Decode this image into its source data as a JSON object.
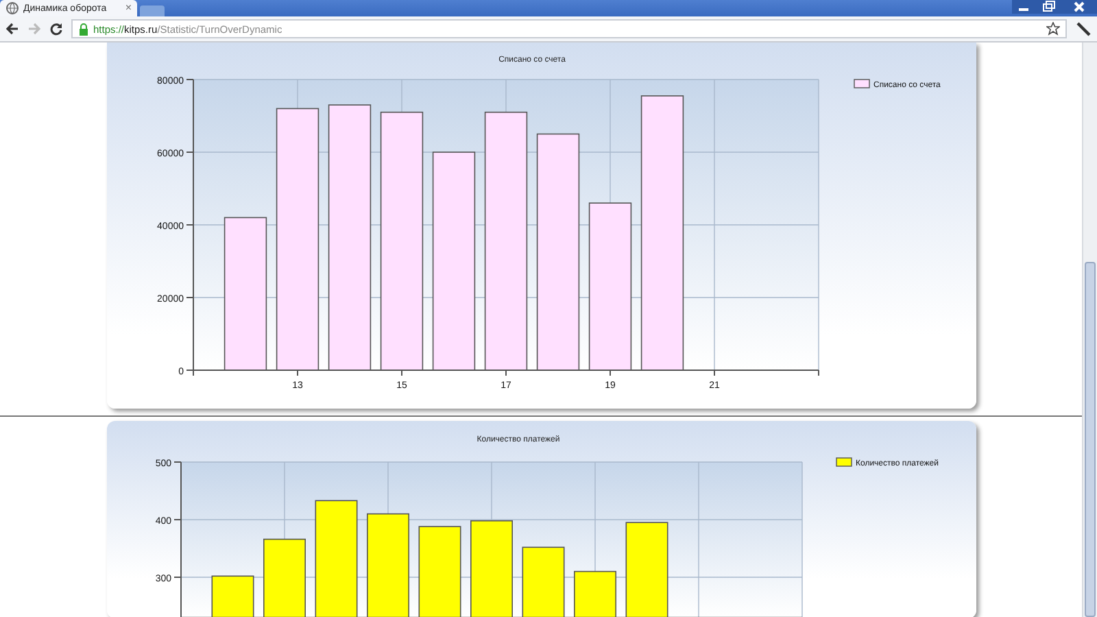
{
  "browser": {
    "tab": {
      "title": "Динамика оборота",
      "close": "×"
    },
    "url": {
      "scheme": "https://",
      "host": "kitps.ru",
      "path": "/Statistic/TurnOverDynamic"
    }
  },
  "charts": [
    {
      "chart_data": {
        "type": "bar",
        "grid": true,
        "title": "Списано со счета",
        "x": [
          12,
          13,
          14,
          15,
          16,
          17,
          18,
          19,
          20
        ],
        "series": [
          {
            "name": "Списано со счета",
            "color": "#ffe0ff",
            "values": [
              42000,
              72000,
              73000,
              71000,
              60000,
              71000,
              65000,
              46000,
              75500
            ]
          }
        ],
        "xlim": [
          11,
          23
        ],
        "ylim": [
          0,
          80000
        ],
        "xticks": [
          13,
          15,
          17,
          19,
          21
        ],
        "yticks": [
          0,
          20000,
          40000,
          60000,
          80000
        ]
      }
    },
    {
      "chart_data": {
        "type": "bar",
        "grid": true,
        "title": "Количество платежей",
        "series": [
          {
            "name": "Количество платежей",
            "color": "#ffff00",
            "values": [
              302,
              366,
              433,
              410,
              388,
              398,
              352,
              310,
              395
            ]
          }
        ],
        "ylim": [
          230,
          500
        ],
        "yticks": [
          300,
          400,
          500
        ]
      }
    }
  ]
}
